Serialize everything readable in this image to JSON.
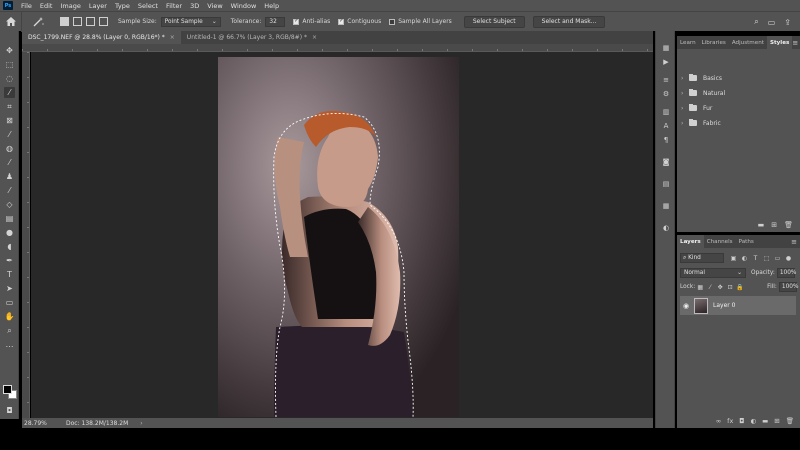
{
  "menubar": {
    "logo": "Ps",
    "items": [
      "File",
      "Edit",
      "Image",
      "Layer",
      "Type",
      "Select",
      "Filter",
      "3D",
      "View",
      "Window",
      "Help"
    ]
  },
  "options": {
    "sample_size_label": "Sample Size:",
    "sample_size_value": "Point Sample",
    "tolerance_label": "Tolerance:",
    "tolerance_value": "32",
    "anti_alias": "Anti-alias",
    "contiguous": "Contiguous",
    "sample_all_layers": "Sample All Layers",
    "select_subject": "Select Subject",
    "select_and_mask": "Select and Mask..."
  },
  "tabs": [
    {
      "label": "DSC_1799.NEF @ 28.8% (Layer 0, RGB/16*) *",
      "close": "×"
    },
    {
      "label": "Untitled-1 @ 66.7% (Layer 3, RGB/8#) *",
      "close": "×"
    }
  ],
  "status": {
    "zoom": "28.79%",
    "doc": "Doc: 138.2M/138.2M",
    "arrow": "›"
  },
  "libraries_panel": {
    "tabs": [
      "Learn",
      "Libraries",
      "Adjustment",
      "Styles"
    ],
    "folders": [
      "Basics",
      "Natural",
      "Fur",
      "Fabric"
    ]
  },
  "layers_panel": {
    "tabs": [
      "Layers",
      "Channels",
      "Paths"
    ],
    "kind": "Kind",
    "blend_mode": "Normal",
    "opacity_label": "Opacity:",
    "opacity_value": "100%",
    "lock_label": "Lock:",
    "fill_label": "Fill:",
    "fill_value": "100%",
    "layers": [
      {
        "name": "Layer 0"
      }
    ],
    "footer_icons": [
      "link-icon",
      "fx-icon",
      "mask-icon",
      "adjustment-icon",
      "group-icon",
      "new-layer-icon",
      "trash-icon"
    ]
  },
  "colors": {
    "ui_bg": "#535353",
    "canvas_bg": "#282828",
    "selected_layer": "#6a6a6a"
  }
}
